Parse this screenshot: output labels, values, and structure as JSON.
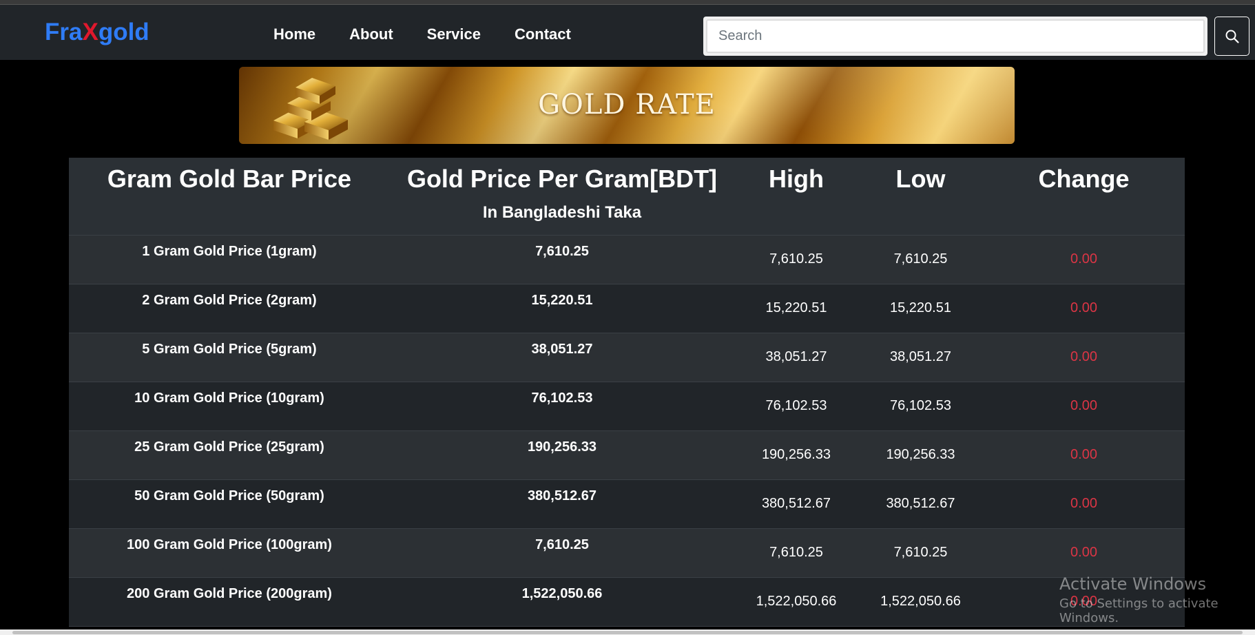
{
  "navbar": {
    "brand_part1": "Fra",
    "brand_part2": "X",
    "brand_part3": "gold",
    "links": [
      "Home",
      "About",
      "Service",
      "Contact"
    ],
    "search_placeholder": "Search",
    "search_icon": "search-icon"
  },
  "banner": {
    "title": "GOLD RATE"
  },
  "table": {
    "headers": {
      "name": "Gram Gold Bar Price",
      "price": "Gold Price Per Gram[BDT]",
      "price_sub": "In Bangladeshi Taka",
      "high": "High",
      "low": "Low",
      "change": "Change"
    },
    "rows": [
      {
        "name": "1 Gram Gold Price (1gram)",
        "price": "7,610.25",
        "high": "7,610.25",
        "low": "7,610.25",
        "change": "0.00"
      },
      {
        "name": "2 Gram Gold Price (2gram)",
        "price": "15,220.51",
        "high": "15,220.51",
        "low": "15,220.51",
        "change": "0.00"
      },
      {
        "name": "5 Gram Gold Price (5gram)",
        "price": "38,051.27",
        "high": "38,051.27",
        "low": "38,051.27",
        "change": "0.00"
      },
      {
        "name": "10 Gram Gold Price (10gram)",
        "price": "76,102.53",
        "high": "76,102.53",
        "low": "76,102.53",
        "change": "0.00"
      },
      {
        "name": "25 Gram Gold Price (25gram)",
        "price": "190,256.33",
        "high": "190,256.33",
        "low": "190,256.33",
        "change": "0.00"
      },
      {
        "name": "50 Gram Gold Price (50gram)",
        "price": "380,512.67",
        "high": "380,512.67",
        "low": "380,512.67",
        "change": "0.00"
      },
      {
        "name": "100 Gram Gold Price (100gram)",
        "price": "7,610.25",
        "high": "7,610.25",
        "low": "7,610.25",
        "change": "0.00"
      },
      {
        "name": "200 Gram Gold Price (200gram)",
        "price": "1,522,050.66",
        "high": "1,522,050.66",
        "low": "1,522,050.66",
        "change": "0.00"
      }
    ]
  },
  "watermark": {
    "title": "Activate Windows",
    "subtitle": "Go to Settings to activate Windows."
  },
  "colors": {
    "brand_blue": "#2f7cf6",
    "brand_x_red": "#e0182d",
    "change_red": "#dc3545",
    "navbar_bg": "#212529",
    "row_odd": "#2c3034",
    "row_even": "#212529"
  }
}
